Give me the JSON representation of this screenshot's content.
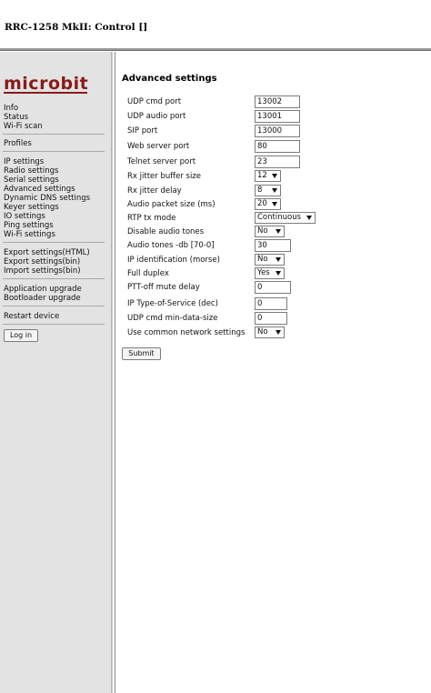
{
  "window": {
    "title": "RRC-1258 MkII: Control []"
  },
  "brand": {
    "logo_text": "microbit",
    "color": "#8a1a1a"
  },
  "sidebar": {
    "group1": [
      "Info",
      "Status",
      "Wi-Fi scan"
    ],
    "group2": [
      "Profiles"
    ],
    "group3": [
      "IP settings",
      "Radio settings",
      "Serial settings",
      "Advanced settings",
      "Dynamic DNS settings",
      "Keyer settings",
      "IO settings",
      "Ping settings",
      "Wi-Fi settings"
    ],
    "group4": [
      "Export settings(HTML)",
      "Export settings(bin)",
      "Import settings(bin)"
    ],
    "group5": [
      "Application upgrade",
      "Bootloader upgrade"
    ],
    "group6": [
      "Restart device"
    ],
    "login_label": "Log in"
  },
  "main": {
    "title": "Advanced settings",
    "fields": [
      {
        "label": "UDP cmd port",
        "type": "text",
        "value": "13002"
      },
      {
        "label": "UDP audio port",
        "type": "text",
        "value": "13001"
      },
      {
        "label": "SIP port",
        "type": "text",
        "value": "13000"
      },
      {
        "label": "Web server port",
        "type": "text",
        "value": "80"
      },
      {
        "label": "Telnet server port",
        "type": "text",
        "value": "23"
      },
      {
        "label": "Rx jitter buffer size",
        "type": "select",
        "value": "12"
      },
      {
        "label": "Rx jitter delay",
        "type": "select",
        "value": "8"
      },
      {
        "label": "Audio packet size (ms)",
        "type": "select",
        "value": "20"
      },
      {
        "label": "RTP tx mode",
        "type": "select",
        "value": "Continuous"
      },
      {
        "label": "Disable audio tones",
        "type": "select",
        "value": "No"
      },
      {
        "label": "Audio tones -db [70-0]",
        "type": "text",
        "value": "30"
      },
      {
        "label": "IP identification (morse)",
        "type": "select",
        "value": "No"
      },
      {
        "label": "Full duplex",
        "type": "select",
        "value": "Yes"
      },
      {
        "label": "PTT-off mute delay",
        "type": "text",
        "value": "0"
      },
      {
        "label": "IP Type-of-Service (dec)",
        "type": "text",
        "value": "0"
      },
      {
        "label": "UDP cmd min-data-size",
        "type": "text",
        "value": "0"
      },
      {
        "label": "Use common network settings",
        "type": "select",
        "value": "No"
      }
    ],
    "submit_label": "Submit"
  }
}
